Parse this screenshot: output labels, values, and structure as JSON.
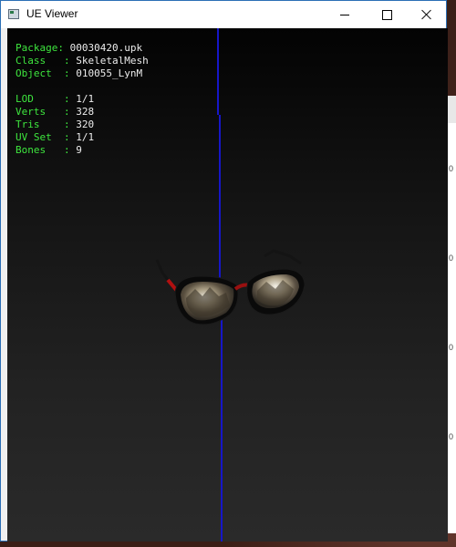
{
  "window": {
    "title": "UE Viewer"
  },
  "info": {
    "package_label": "Package: ",
    "package_value": "00030420.upk",
    "class_label": "Class   : ",
    "class_value": "SkeletalMesh",
    "object_label": "Object  : ",
    "object_value": "010055_LynM",
    "lod_label": "LOD     : ",
    "lod_value": "1/1",
    "verts_label": "Verts   : ",
    "verts_value": "328",
    "tris_label": "Tris    : ",
    "tris_value": "320",
    "uvset_label": "UV Set  : ",
    "uvset_value": "1/1",
    "bones_label": "Bones   : ",
    "bones_value": "9"
  },
  "colors": {
    "label_green": "#3ee63e",
    "value_white": "#ececec",
    "axis_blue": "#1616c8",
    "window_border": "#2b6fb6"
  },
  "icons": {
    "app": "ue-viewer-app-icon",
    "minimize": "minimize-icon",
    "maximize": "maximize-icon",
    "close": "close-icon"
  }
}
